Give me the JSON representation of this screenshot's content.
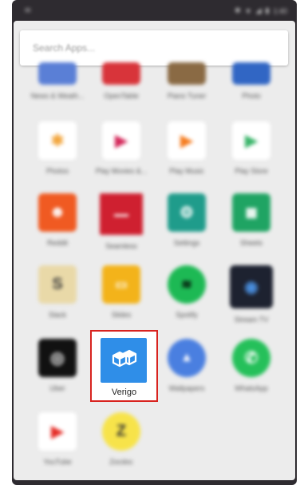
{
  "status": {
    "time": "1:40"
  },
  "search": {
    "placeholder": "Search Apps..."
  },
  "apps": {
    "row0": [
      "News & Weath...",
      "OpenTable",
      "Piano Tuner",
      "Photo"
    ],
    "row1": [
      "Photos",
      "Play Movies &...",
      "Play Music",
      "Play Store"
    ],
    "row2": [
      "Reddit",
      "Seamless",
      "Settings",
      "Sheets"
    ],
    "row3": [
      "Slack",
      "Slides",
      "Spotify",
      "Stream TV"
    ],
    "row4": [
      "Uber",
      "Verigo",
      "Wallpapers",
      "WhatsApp"
    ],
    "row5": [
      "YouTube",
      "Zocdoc"
    ]
  },
  "highlighted_app": {
    "label": "Verigo",
    "color": "#2f8ee8",
    "border_color": "#d8231f"
  }
}
